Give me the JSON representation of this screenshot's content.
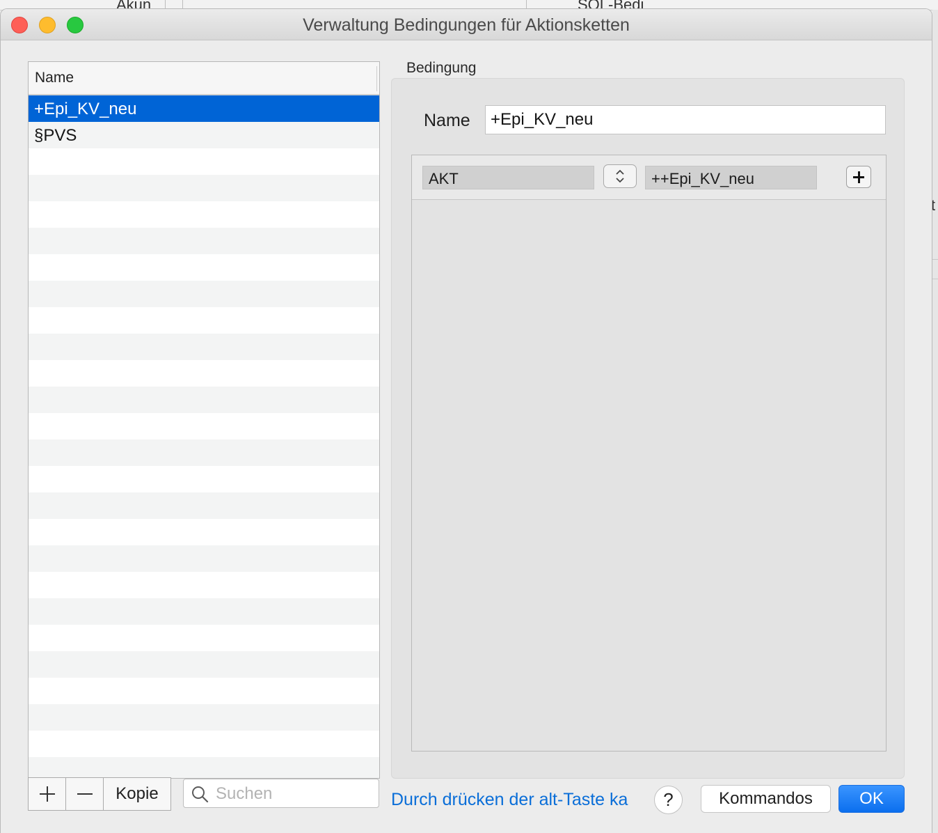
{
  "background_window": {
    "tab_text_left": "Akun",
    "tab_text_right": "SQL-Bedi",
    "right_edge_char": "t"
  },
  "window": {
    "title": "Verwaltung Bedingungen für Aktionsketten"
  },
  "list": {
    "header": "Name",
    "rows": [
      "+Epi_KV_neu",
      "§PVS",
      "",
      "",
      "",
      "",
      "",
      "",
      "",
      "",
      "",
      "",
      "",
      "",
      "",
      "",
      "",
      "",
      "",
      "",
      "",
      "",
      "",
      "",
      "",
      "",
      ""
    ],
    "selected_index": 0
  },
  "list_toolbar": {
    "copy_label": "Kopie",
    "search_placeholder": "Suchen",
    "search_value": ""
  },
  "detail": {
    "group_label": "Bedingung",
    "name_label": "Name",
    "name_value": "+Epi_KV_neu",
    "condition": {
      "left_value": "AKT",
      "right_value": "++Epi_KV_neu"
    }
  },
  "footer": {
    "hint_text": "Durch drücken der alt-Taste ka",
    "help_label": "?",
    "commands_label": "Kommandos",
    "ok_label": "OK"
  },
  "colors": {
    "selection": "#0064d6",
    "link": "#0a6ed8",
    "ok_button": "#1a7ff5"
  }
}
